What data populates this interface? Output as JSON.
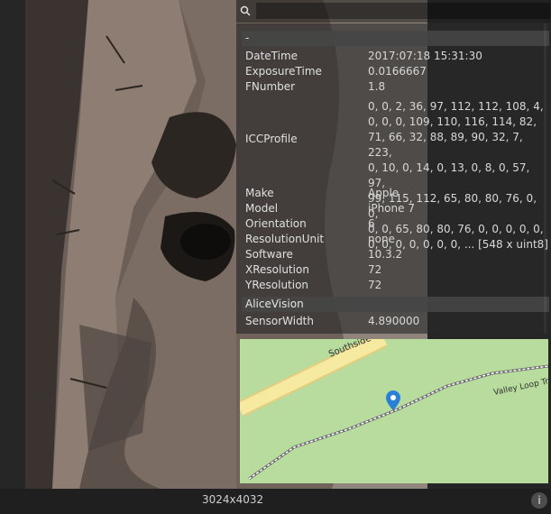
{
  "viewer": {
    "resolution": "3024x4032",
    "info_icon": "info-icon"
  },
  "search": {
    "value": "",
    "placeholder": ""
  },
  "metadata": {
    "section_exif": "-",
    "exif_rows": [
      {
        "key": "DateTime",
        "value": "2017:07:18 15:31:30"
      },
      {
        "key": "ExposureTime",
        "value": "0.0166667"
      },
      {
        "key": "FNumber",
        "value": "1.8"
      }
    ],
    "icc": {
      "key": "ICCProfile",
      "lines": [
        "0, 0, 2, 36, 97, 112, 112, 108, 4,",
        "0, 0, 0, 109, 110, 116, 114, 82,",
        "71, 66, 32, 88, 89, 90, 32, 7, 223,",
        "0, 10, 0, 14, 0, 13, 0, 8, 0, 57, 97,",
        "99, 115, 112, 65, 80, 80, 76, 0, 0,",
        "0, 0, 65, 80, 80, 76, 0, 0, 0, 0, 0,",
        "0, 0, 0, 0, 0, 0, 0, ... [548 x uint8]"
      ]
    },
    "rows_after": [
      {
        "key": "Make",
        "value": "Apple"
      },
      {
        "key": "Model",
        "value": "iPhone 7"
      },
      {
        "key": "Orientation",
        "value": "6"
      },
      {
        "key": "ResolutionUnit",
        "value": "none"
      },
      {
        "key": "Software",
        "value": "10.3.2"
      },
      {
        "key": "XResolution",
        "value": "72"
      },
      {
        "key": "YResolution",
        "value": "72"
      }
    ],
    "section_alicevision": "AliceVision",
    "alicevision_rows": [
      {
        "key": "SensorWidth",
        "value": "4.890000"
      }
    ]
  },
  "map": {
    "road_label": "Southside",
    "trail_label": "Valley Loop Trail",
    "land_color": "#b8dc9e",
    "road_color": "#f6eaa0",
    "pin_color": "#2a7fd6"
  }
}
